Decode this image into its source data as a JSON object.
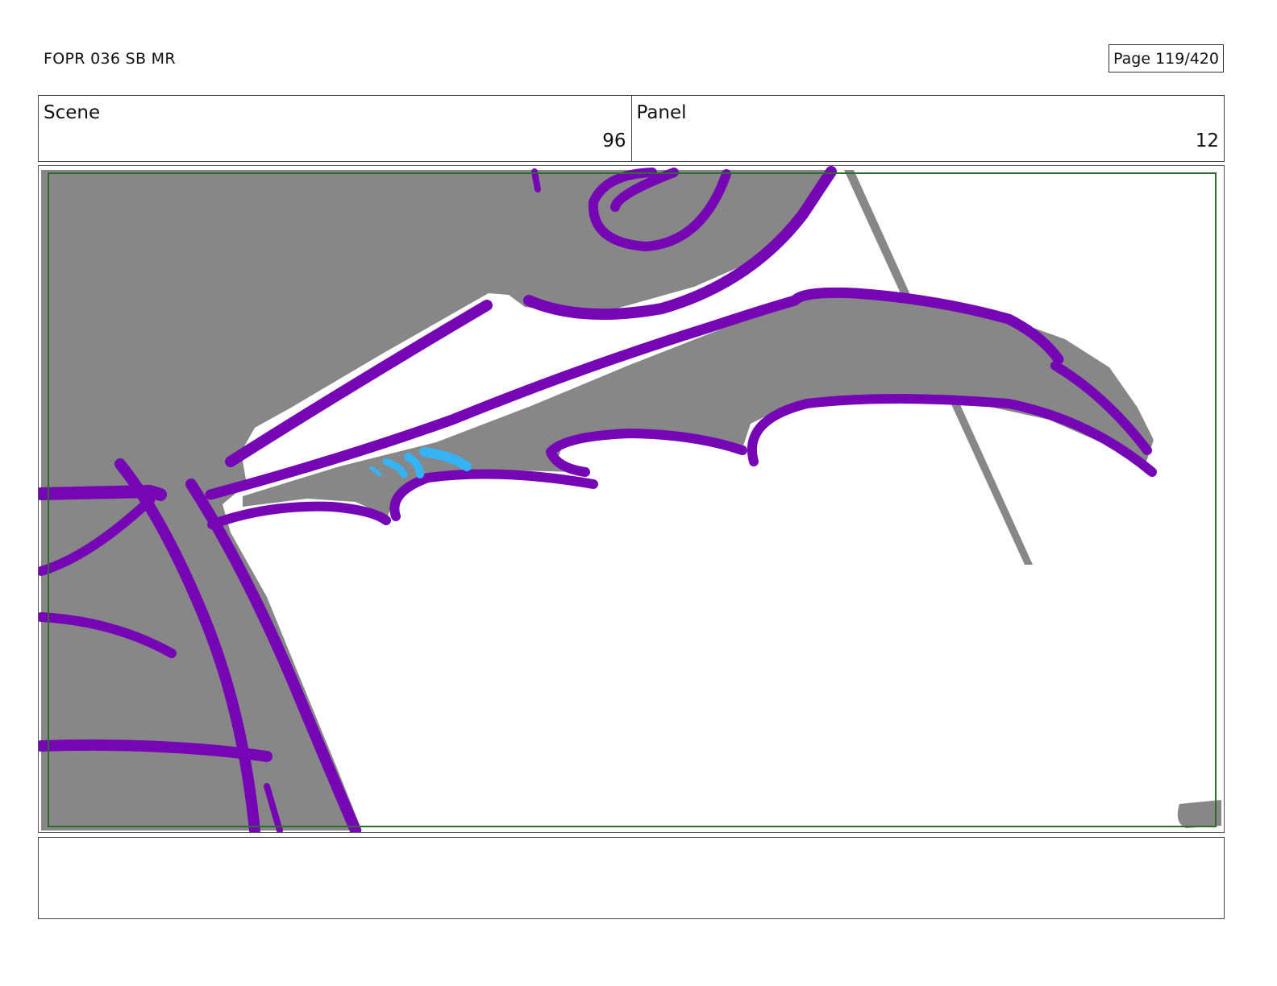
{
  "header": {
    "doc_title": "FOPR 036 SB MR",
    "page_label": "Page 119/420"
  },
  "info": {
    "scene_label": "Scene",
    "scene_value": "96",
    "panel_label": "Panel",
    "panel_value": "12"
  },
  "artwork": {
    "subject_icon": "storyboard-sketch-icon",
    "colors": {
      "line": "#7505b5",
      "fill": "#878787",
      "accent": "#35b3f5",
      "safe_frame": "#2f6b2f"
    }
  },
  "notes": {
    "text": ""
  }
}
